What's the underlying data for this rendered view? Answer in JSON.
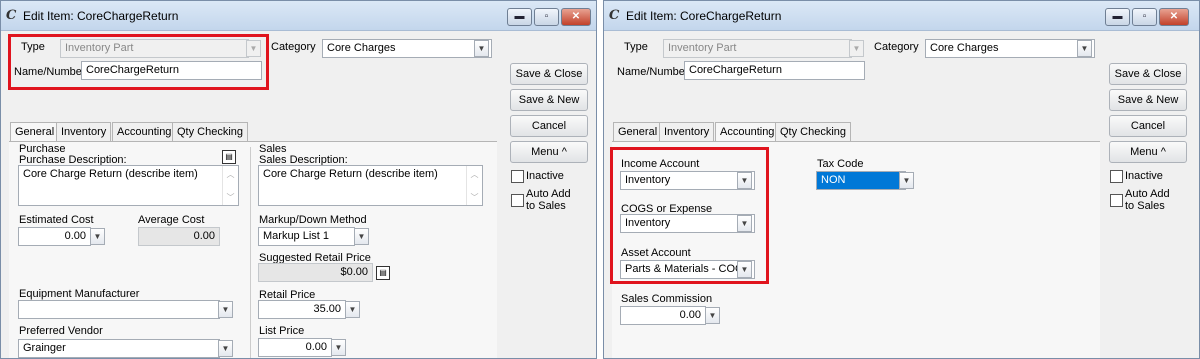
{
  "window": {
    "title": "Edit Item: CoreChargeReturn",
    "minimize": "▬",
    "maximize": "▫",
    "close": "✕",
    "icon_glyph": "C"
  },
  "form": {
    "type_label": "Type",
    "type_value": "Inventory Part",
    "category_label": "Category",
    "category_value": "Core Charges",
    "name_label": "Name/Number",
    "name_value": "CoreChargeReturn"
  },
  "buttons": {
    "save_close": "Save & Close",
    "save_new": "Save & New",
    "cancel": "Cancel",
    "menu": "Menu ^"
  },
  "checkboxes": {
    "inactive": "Inactive",
    "auto_add": "Auto Add to Sales"
  },
  "tabs": [
    "General",
    "Inventory",
    "Accounting",
    "Qty Checking"
  ],
  "general": {
    "purchase_header": "Purchase",
    "purchase_desc_label": "Purchase Description:",
    "purchase_desc": "Core Charge Return (describe item)",
    "sales_header": "Sales",
    "sales_desc_label": "Sales Description:",
    "sales_desc": "Core Charge Return (describe item)",
    "est_cost_label": "Estimated Cost",
    "est_cost": "0.00",
    "avg_cost_label": "Average Cost",
    "avg_cost": "0.00",
    "markup_label": "Markup/Down Method",
    "markup_value": "Markup List 1",
    "suggested_label": "Suggested Retail Price",
    "suggested_value": "$0.00",
    "equip_label": "Equipment Manufacturer",
    "equip_value": "",
    "retail_label": "Retail Price",
    "retail_value": "35.00",
    "vendor_label": "Preferred Vendor",
    "vendor_value": "Grainger",
    "list_label": "List Price",
    "list_value": "0.00"
  },
  "accounting": {
    "income_label": "Income Account",
    "income_value": "Inventory",
    "cogs_label": "COGS or Expense",
    "cogs_value": "Inventory",
    "asset_label": "Asset Account",
    "asset_value": "Parts & Materials - COGS",
    "tax_label": "Tax Code",
    "tax_value": "NON",
    "commission_label": "Sales Commission",
    "commission_value": "0.00"
  },
  "colors": {
    "highlight": "#e0141e",
    "selection": "#0078d7"
  },
  "icons": {
    "dropdown": "chevron-down-icon",
    "scroll_up": "scroll-up-icon",
    "scroll_down": "scroll-down-icon",
    "note": "note-icon"
  }
}
